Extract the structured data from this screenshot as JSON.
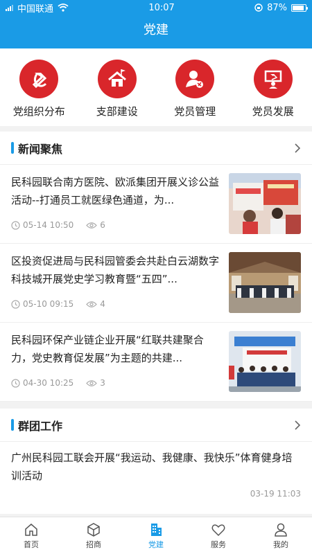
{
  "status": {
    "carrier": "中国联通",
    "time": "10:07",
    "battery": "87%",
    "battery_level": 0.87
  },
  "header": {
    "title": "党建"
  },
  "quick_links": [
    {
      "label": "党组织分布",
      "icon": "party-emblem-icon"
    },
    {
      "label": "支部建设",
      "icon": "building-flag-icon"
    },
    {
      "label": "党员管理",
      "icon": "member-icon"
    },
    {
      "label": "党员发展",
      "icon": "presentation-icon"
    }
  ],
  "news": {
    "title": "新闻聚焦",
    "items": [
      {
        "title": "民科园联合南方医院、欧派集团开展义诊公益活动--打通员工就医绿色通道，为...",
        "date": "05-14 10:50",
        "views": "6"
      },
      {
        "title": "区投资促进局与民科园管委会共赴白云湖数字科技城开展党史学习教育暨“五四”...",
        "date": "05-10 09:15",
        "views": "4"
      },
      {
        "title": "民科园环保产业链企业开展“红联共建聚合力，党史教育促发展”为主题的共建...",
        "date": "04-30 10:25",
        "views": "3"
      }
    ]
  },
  "group": {
    "title": "群团工作",
    "items": [
      {
        "title": "广州民科园工联会开展“我运动、我健康、我快乐”体育健身培训活动",
        "date": "03-19 11:03"
      }
    ]
  },
  "tabs": [
    {
      "label": "首页",
      "icon": "home-icon"
    },
    {
      "label": "招商",
      "icon": "cube-icon"
    },
    {
      "label": "党建",
      "icon": "building-icon"
    },
    {
      "label": "服务",
      "icon": "heart-icon"
    },
    {
      "label": "我的",
      "icon": "person-icon"
    }
  ],
  "colors": {
    "primary": "#1a9be6",
    "party_red": "#d9262b"
  }
}
